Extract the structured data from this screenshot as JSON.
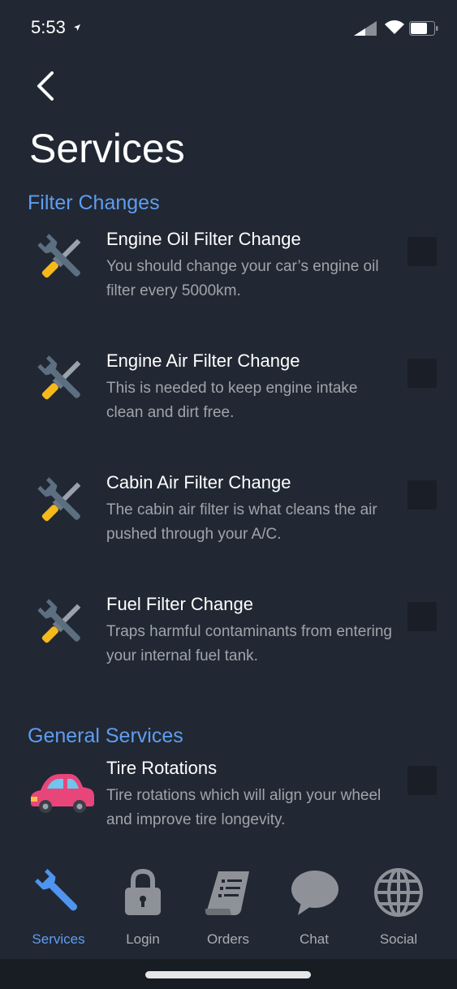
{
  "status": {
    "time": "5:53"
  },
  "page": {
    "title": "Services"
  },
  "sections": [
    {
      "title": "Filter Changes",
      "items": [
        {
          "icon": "tools-icon",
          "title": "Engine Oil Filter Change",
          "description": "You should change your car’s engine oil filter every 5000km.",
          "checked": false
        },
        {
          "icon": "tools-icon",
          "title": "Engine Air Filter Change",
          "description": "This is needed to keep engine intake clean and dirt free.",
          "checked": false
        },
        {
          "icon": "tools-icon",
          "title": "Cabin Air Filter Change",
          "description": "The cabin air filter is what cleans the air pushed through your A/C.",
          "checked": false
        },
        {
          "icon": "tools-icon",
          "title": "Fuel Filter Change",
          "description": "Traps harmful contaminants from entering your internal fuel tank.",
          "checked": false
        }
      ]
    },
    {
      "title": "General Services",
      "items": [
        {
          "icon": "car-icon",
          "title": "Tire Rotations",
          "description": "Tire rotations which will align your wheel and improve tire longevity.",
          "checked": false
        }
      ]
    }
  ],
  "tabs": [
    {
      "label": "Services",
      "icon": "wrench-icon",
      "active": true
    },
    {
      "label": "Login",
      "icon": "lock-icon",
      "active": false
    },
    {
      "label": "Orders",
      "icon": "receipt-icon",
      "active": false
    },
    {
      "label": "Chat",
      "icon": "speech-bubble-icon",
      "active": false
    },
    {
      "label": "Social",
      "icon": "globe-icon",
      "active": false
    }
  ],
  "colors": {
    "background": "#212833",
    "accent": "#5f9df0",
    "description_text": "#a0a4aa"
  }
}
